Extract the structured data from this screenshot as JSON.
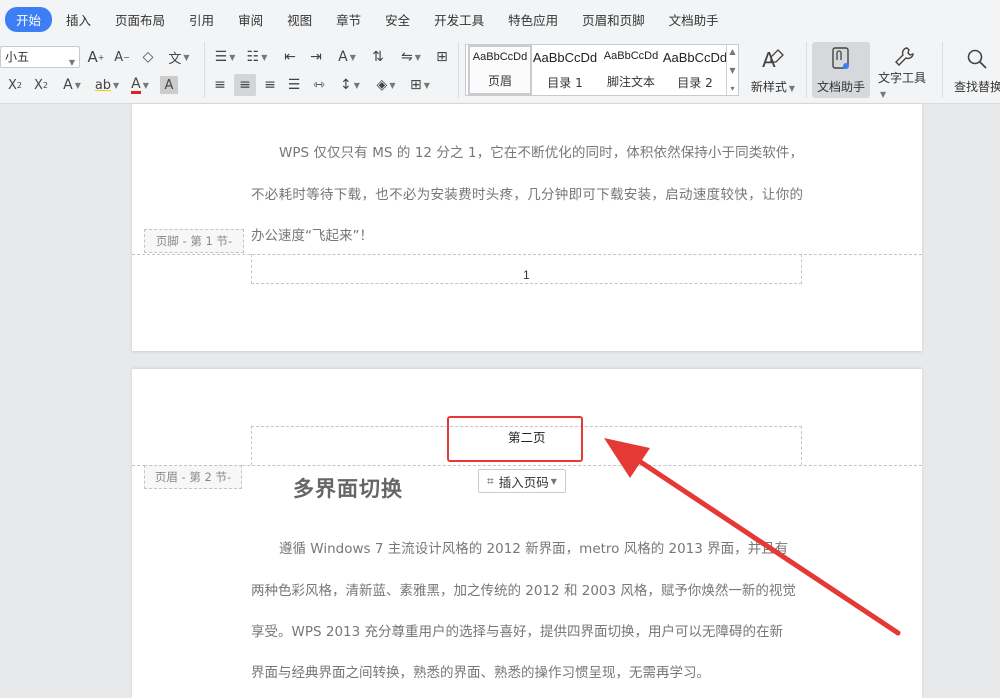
{
  "menu": {
    "tabs": [
      "开始",
      "插入",
      "页面布局",
      "引用",
      "审阅",
      "视图",
      "章节",
      "安全",
      "开发工具",
      "特色应用",
      "页眉和页脚",
      "文档助手"
    ]
  },
  "ribbon": {
    "font_size_value": "小五",
    "styles": [
      {
        "sample": "AaBbCcDd",
        "name": "页眉"
      },
      {
        "sample": "AaBbCcDd",
        "name": "目录 1"
      },
      {
        "sample": "AaBbCcDd",
        "name": "脚注文本"
      },
      {
        "sample": "AaBbCcDd",
        "name": "目录 2"
      }
    ],
    "new_style_label": "新样式",
    "doc_helper_label": "文档助手",
    "text_tools_label": "文字工具",
    "find_replace_label": "查找替换"
  },
  "page1": {
    "paragraph": "WPS 仅仅只有 MS 的 12 分之 1，它在不断优化的同时，体积依然保持小于同类软件，不必耗时等待下载，也不必为安装费时头疼，几分钟即可下载安装，启动速度较快，让你的办公速度“飞起来”！",
    "footer_tag": "页脚 - 第 1 节-",
    "page_number": "1"
  },
  "page2": {
    "header_tag": "页眉 - 第 2 节-",
    "header_text": "第二页",
    "insert_page_number_label": "插入页码",
    "heading": "多界面切换",
    "lines": [
      "遵循 Windows 7 主流设计风格的 2012 新界面，metro 风格的 2013 界面，并且有",
      "两种色彩风格，清新蓝、素雅黑，加之传统的 2012 和 2003 风格，赋予你焕然一新的视觉",
      "享受。WPS 2013 充分尊重用户的选择与喜好，提供四界面切换，用户可以无障碍的在新",
      "界面与经典界面之间转换，熟悉的界面、熟悉的操作习惯呈现，无需再学习。"
    ]
  },
  "colors": {
    "active_tab": "#3d7ef5",
    "annotation_red": "#e53935"
  }
}
